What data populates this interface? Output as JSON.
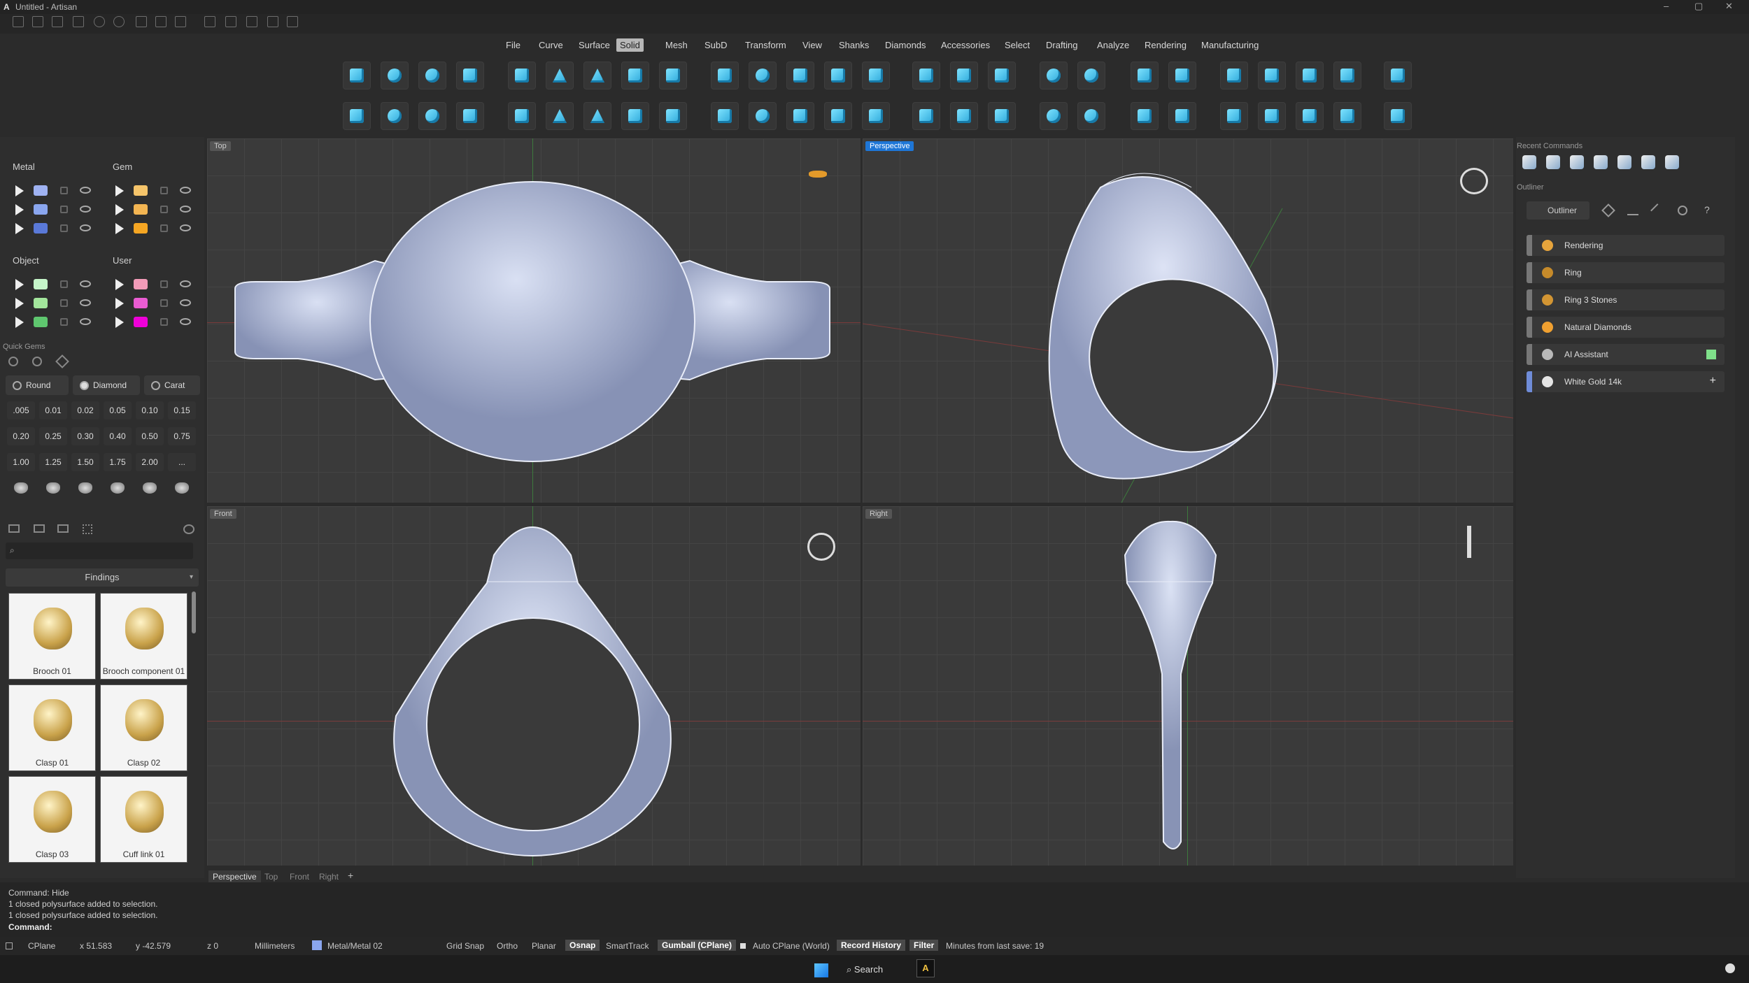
{
  "app": {
    "title": "Untitled - Artisan"
  },
  "menu": [
    "File",
    "Curve",
    "Surface",
    "Solid",
    "Mesh",
    "SubD",
    "Transform",
    "View",
    "Shanks",
    "Diamonds",
    "Accessories",
    "Select",
    "Drafting",
    "Analyze",
    "Rendering",
    "Manufacturing"
  ],
  "menu_active": "Solid",
  "layers": {
    "metal": {
      "title": "Metal",
      "colors": [
        "#9fb2f2",
        "#8aa6ef",
        "#5a79d8"
      ]
    },
    "gem": {
      "title": "Gem",
      "colors": [
        "#f5c46a",
        "#f3b552",
        "#f5a623"
      ]
    },
    "object": {
      "title": "Object",
      "colors": [
        "#c5f5c9",
        "#a3e69c",
        "#5fc76f"
      ]
    },
    "user": {
      "title": "User",
      "colors": [
        "#f29bb8",
        "#ea5cd2",
        "#ee00d8"
      ]
    }
  },
  "quick_gems": {
    "title": "Quick Gems",
    "chips": [
      "Round",
      "Diamond",
      "Carat"
    ],
    "sizes": [
      ".005",
      "0.01",
      "0.02",
      "0.05",
      "0.10",
      "0.15",
      "0.20",
      "0.25",
      "0.30",
      "0.40",
      "0.50",
      "0.75",
      "1.00",
      "1.25",
      "1.50",
      "1.75",
      "2.00",
      "..."
    ]
  },
  "library": {
    "category": "Findings",
    "items": [
      "Brooch 01",
      "Brooch component 01",
      "Clasp 01",
      "Clasp 02",
      "Clasp 03",
      "Cuff link 01"
    ]
  },
  "viewports": {
    "top": "Top",
    "perspective": "Perspective",
    "front": "Front",
    "right": "Right"
  },
  "viewport_tabs": [
    "Perspective",
    "Top",
    "Front",
    "Right"
  ],
  "right": {
    "recent_title": "Recent Commands",
    "outliner_section": "Outliner",
    "outliner_tab": "Outliner",
    "items": [
      "Rendering",
      "Ring",
      "Ring 3 Stones",
      "Natural Diamonds",
      "AI Assistant",
      "White Gold 14k"
    ]
  },
  "command": {
    "lines": [
      "Command: Hide",
      "1 closed polysurface added to selection.",
      "1 closed polysurface added to selection."
    ],
    "prompt": "Command:"
  },
  "status": {
    "cplane": "CPlane",
    "x": "x 51.583",
    "y": "y -42.579",
    "z": "z 0",
    "units": "Millimeters",
    "layer": "Metal/Metal 02",
    "grid_snap": "Grid Snap",
    "ortho": "Ortho",
    "planar": "Planar",
    "osnap": "Osnap",
    "smarttrack": "SmartTrack",
    "gumball": "Gumball (CPlane)",
    "auto_cplane": "Auto CPlane (World)",
    "record_history": "Record History",
    "filter": "Filter",
    "minutes": "Minutes from last save: 19"
  },
  "taskbar": {
    "search": "Search"
  }
}
